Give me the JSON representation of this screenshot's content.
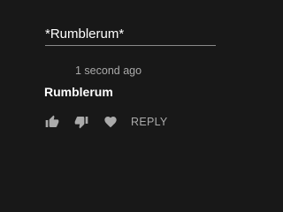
{
  "reply_input": {
    "value": "*Rumblerum*"
  },
  "comment": {
    "timestamp": "1 second ago",
    "text": "Rumblerum"
  },
  "actions": {
    "like_icon": "thumbs-up-icon",
    "dislike_icon": "thumbs-down-icon",
    "heart_icon": "heart-icon",
    "reply_label": "REPLY"
  },
  "colors": {
    "background": "#181818",
    "text_primary": "#ffffff",
    "text_secondary": "#aaaaaa",
    "underline": "#8a8a8a"
  }
}
